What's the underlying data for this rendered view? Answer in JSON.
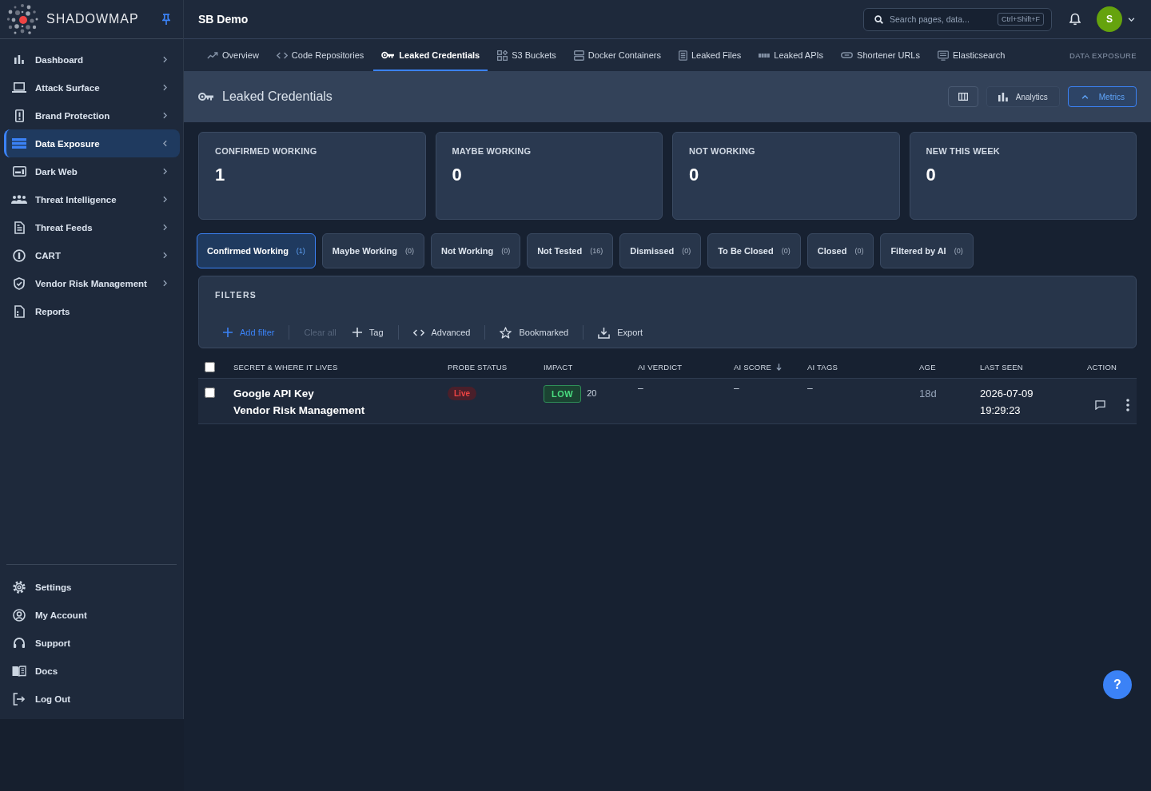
{
  "sidebar": {
    "brand": "SHADOWMAP",
    "pinned": true,
    "nav": [
      {
        "label": "Dashboard",
        "selected": false,
        "submenu": true
      },
      {
        "label": "Attack Surface",
        "selected": false,
        "submenu": true
      },
      {
        "label": "Brand Protection",
        "selected": false,
        "submenu": true
      },
      {
        "label": "Data Exposure",
        "selected": true,
        "submenu": true
      },
      {
        "label": "Dark Web",
        "selected": false,
        "submenu": true
      },
      {
        "label": "Threat Intelligence",
        "selected": false,
        "submenu": true
      },
      {
        "label": "Threat Feeds",
        "selected": false,
        "submenu": true
      },
      {
        "label": "CART",
        "selected": false,
        "submenu": true
      },
      {
        "label": "Vendor Risk Management",
        "selected": false,
        "submenu": true
      },
      {
        "label": "Reports",
        "selected": false,
        "submenu": false
      }
    ],
    "footer_nav": [
      {
        "label": "Settings"
      },
      {
        "label": "My Account"
      },
      {
        "label": "Support"
      },
      {
        "label": "Docs"
      },
      {
        "label": "Log Out"
      }
    ]
  },
  "topbar": {
    "workspace": "SB Demo",
    "search": {
      "placeholder": "Search pages, data...",
      "shortcut": "Ctrl+Shift+F"
    },
    "avatar": {
      "initial": "S"
    }
  },
  "tabs": [
    {
      "label": "Overview",
      "selected": false
    },
    {
      "label": "Code Repositories",
      "selected": false
    },
    {
      "label": "Leaked Credentials",
      "selected": true
    },
    {
      "label": "S3 Buckets",
      "selected": false
    },
    {
      "label": "Docker Containers",
      "selected": false
    },
    {
      "label": "Leaked Files",
      "selected": false
    },
    {
      "label": "Leaked APIs",
      "selected": false
    },
    {
      "label": "Shortener URLs",
      "selected": false
    },
    {
      "label": "Elasticsearch",
      "selected": false
    }
  ],
  "section_label": "DATA EXPOSURE",
  "page_header": {
    "title": "Leaked Credentials",
    "analytics": {
      "label": "Analytics"
    },
    "metrics": {
      "label": "Metrics",
      "expanded": true
    }
  },
  "metric_cards": [
    {
      "label": "CONFIRMED WORKING",
      "value": "1"
    },
    {
      "label": "MAYBE WORKING",
      "value": "0"
    },
    {
      "label": "NOT WORKING",
      "value": "0"
    },
    {
      "label": "NEW THIS WEEK",
      "value": "0"
    }
  ],
  "status_tabs": [
    {
      "label": "Confirmed Working",
      "count": "(1)",
      "selected": true
    },
    {
      "label": "Maybe Working",
      "count": "(0)",
      "selected": false
    },
    {
      "label": "Not Working",
      "count": "(0)",
      "selected": false
    },
    {
      "label": "Not Tested",
      "count": "(16)",
      "selected": false
    },
    {
      "label": "Dismissed",
      "count": "(0)",
      "selected": false
    },
    {
      "label": "To Be Closed",
      "count": "(0)",
      "selected": false
    },
    {
      "label": "Closed",
      "count": "(0)",
      "selected": false
    },
    {
      "label": "Filtered by AI",
      "count": "(0)",
      "selected": false
    }
  ],
  "filters": {
    "title": "FILTERS",
    "actions": [
      {
        "kind": "add",
        "label": "Add filter",
        "disabled": false
      },
      {
        "kind": "clear",
        "label": "Clear all",
        "disabled": true
      },
      {
        "kind": "tag",
        "label": "Tag",
        "disabled": false
      },
      {
        "kind": "advanced",
        "label": "Advanced",
        "disabled": false
      },
      {
        "kind": "bookmark",
        "label": "Bookmarked",
        "disabled": false
      },
      {
        "kind": "export",
        "label": "Export",
        "disabled": false
      }
    ]
  },
  "table": {
    "select_all": {
      "checked": false
    },
    "columns": [
      {
        "label": "SECRET & WHERE IT LIVES",
        "sorted": false
      },
      {
        "label": "PROBE STATUS",
        "sorted": false
      },
      {
        "label": "IMPACT",
        "sorted": false
      },
      {
        "label": "AI VERDICT",
        "sorted": false
      },
      {
        "label": "AI SCORE",
        "sorted": true
      },
      {
        "label": "AI TAGS",
        "sorted": false
      },
      {
        "label": "AGE",
        "sorted": false
      },
      {
        "label": "LAST SEEN",
        "sorted": false
      },
      {
        "label": "ACTION",
        "sorted": false
      }
    ],
    "rows": [
      {
        "checked": false,
        "secret": "Google API Key",
        "location": "Vendor Risk Management",
        "probe_status": "Live",
        "impact": "LOW",
        "impact_score": "20",
        "ai_verdict": "–",
        "ai_score": "–",
        "ai_tags": "–",
        "age": "18d",
        "last_seen": "2026-07-09 19:29:23"
      }
    ]
  },
  "help_button": {
    "label": "?"
  }
}
